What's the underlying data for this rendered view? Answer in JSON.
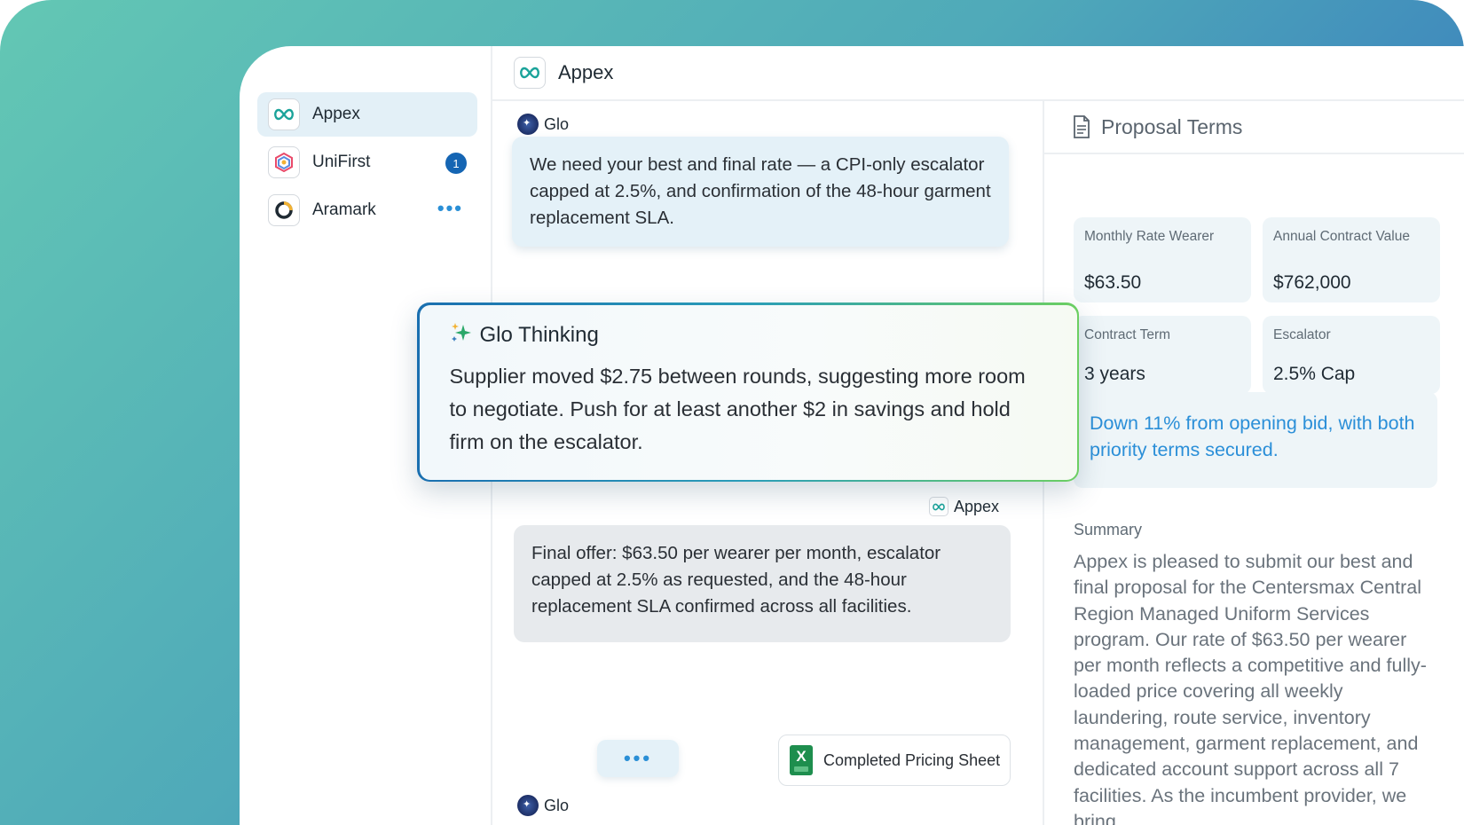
{
  "sidebar": {
    "items": [
      {
        "label": "Appex",
        "icon": "appex-logo-icon",
        "active": true
      },
      {
        "label": "UniFirst",
        "icon": "unifirst-logo-icon",
        "badge": "1"
      },
      {
        "label": "Aramark",
        "icon": "aramark-logo-icon",
        "more": "•••"
      }
    ]
  },
  "header": {
    "title": "Appex"
  },
  "chat": {
    "messages": [
      {
        "sender": "Glo",
        "text": "We need your best and final rate — a CPI-only escalator capped at 2.5%, and confirmation of the 48-hour garment replacement SLA."
      },
      {
        "sender": "Appex",
        "text": "Final offer: $63.50 per wearer per month, escalator capped at 2.5% as requested, and the 48-hour replacement SLA confirmed across all facilities."
      }
    ],
    "attachment": {
      "label": "Completed Pricing Sheet",
      "icon": "excel-file-icon",
      "icon_letter": "X"
    },
    "typing": {
      "sender": "Glo",
      "dots": "•••"
    }
  },
  "thinking": {
    "title": "Glo Thinking",
    "text": "Supplier moved $2.75 between rounds, suggesting more room to negotiate. Push for at least another $2 in savings and hold firm on the escalator."
  },
  "panel": {
    "title": "Proposal Terms",
    "terms": [
      {
        "label": "Monthly Rate Wearer",
        "value": "$63.50"
      },
      {
        "label": "Annual Contract Value",
        "value": "$762,000"
      },
      {
        "label": "Contract Term",
        "value": "3 years"
      },
      {
        "label": "Escalator",
        "value": "2.5% Cap"
      }
    ],
    "highlight": "Down 11% from opening bid, with both priority terms secured.",
    "summary_label": "Summary",
    "summary": "Appex is pleased to submit our best and final proposal for the Centersmax Central Region Managed Uniform Services program. Our rate of $63.50 per wearer per month reflects a competitive and fully-loaded price covering all weekly laundering, route service, inventory management, garment replacement, and dedicated account support across all 7 facilities. As the incumbent provider, we bring"
  },
  "colors": {
    "accent": "#2a8fd6",
    "badge": "#1565b3",
    "brand_teal": "#1aa39a",
    "excel": "#1e8e4e"
  }
}
